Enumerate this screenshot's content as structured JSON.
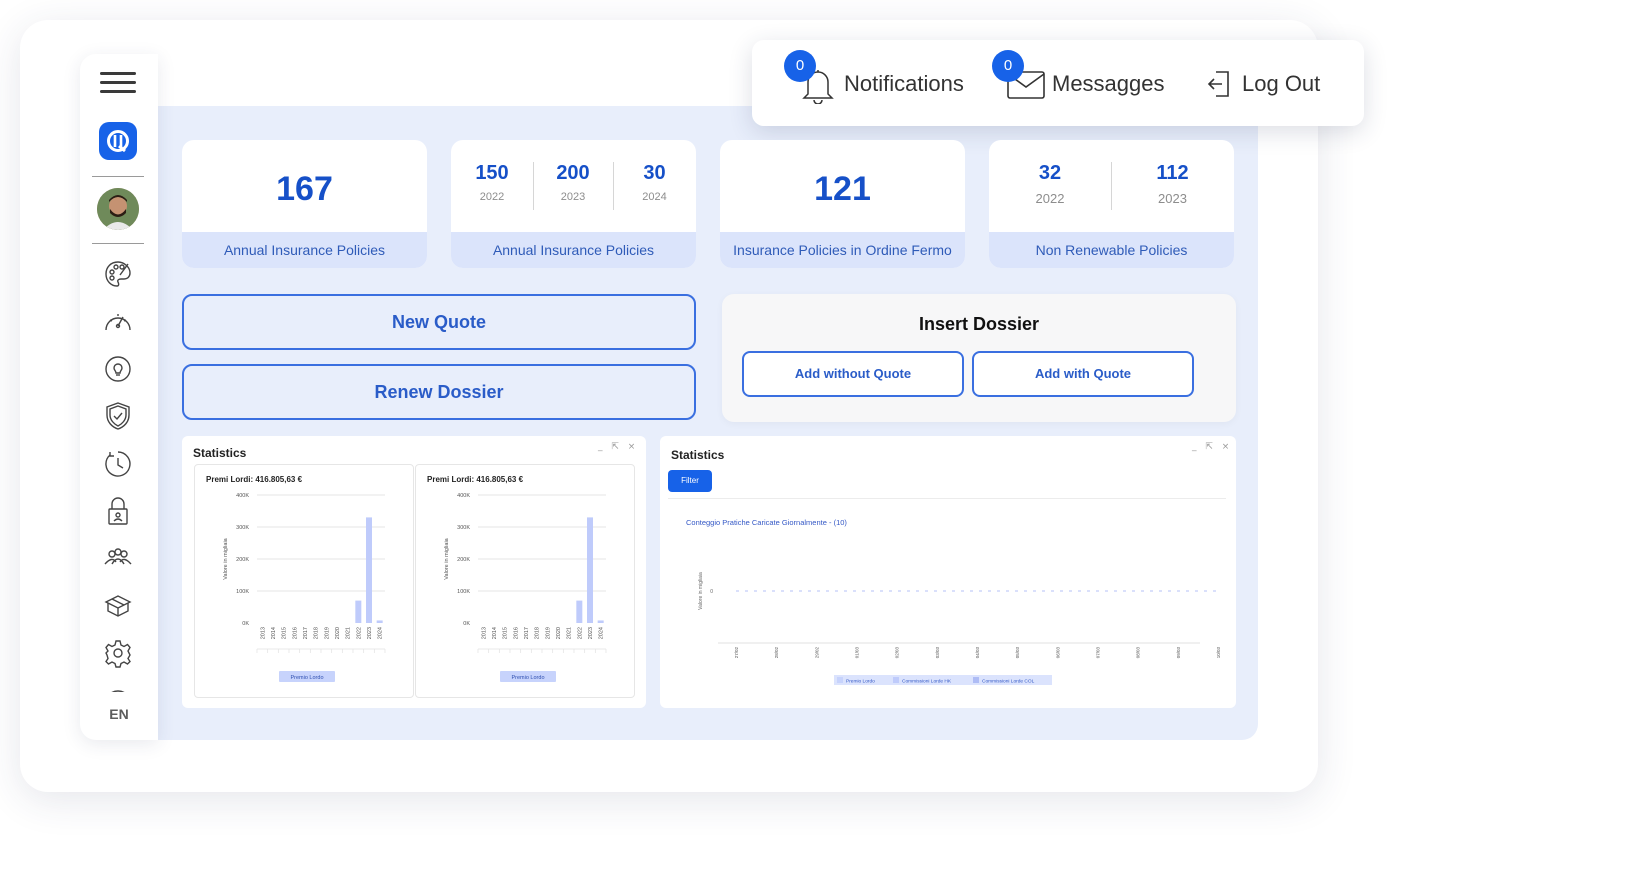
{
  "sidebar": {
    "language": "EN",
    "icons": [
      "palette-icon",
      "speedometer-icon",
      "lightbulb-icon",
      "shield-check-icon",
      "clock-icon",
      "lock-icon",
      "users-icon",
      "package-icon",
      "gear-icon"
    ]
  },
  "header": {
    "notifications": {
      "label": "Notifications",
      "count": "0"
    },
    "messages": {
      "label": "Messagges",
      "count": "0"
    },
    "logout": {
      "label": "Log Out"
    }
  },
  "kpis": [
    {
      "value": "167",
      "label": "Annual Insurance Policies"
    },
    {
      "sub": [
        {
          "value": "150",
          "year": "2022"
        },
        {
          "value": "200",
          "year": "2023"
        },
        {
          "value": "30",
          "year": "2024"
        }
      ],
      "label": "Annual Insurance Policies"
    },
    {
      "value": "121",
      "label": "Insurance Policies in Ordine Fermo"
    },
    {
      "sub": [
        {
          "value": "32",
          "year": "2022"
        },
        {
          "value": "112",
          "year": "2023"
        }
      ],
      "label": "Non Renewable Policies"
    }
  ],
  "actions": {
    "new_quote": "New Quote",
    "renew_dossier": "Renew Dossier",
    "insert_dossier": {
      "title": "Insert Dossier",
      "add_without_quote": "Add without Quote",
      "add_with_quote": "Add with Quote"
    }
  },
  "stats_left": {
    "title": "Statistics",
    "controls": [
      "_",
      "⇱",
      "×"
    ]
  },
  "stats_right": {
    "title": "Statistics",
    "filter_label": "Filter",
    "controls": [
      "_",
      "⇱",
      "×"
    ]
  },
  "chart_data": [
    {
      "type": "bar",
      "title": "Premi Lordi: 416.805,63 €",
      "ylabel": "Valore in migliaia",
      "categories": [
        "2013",
        "2014",
        "2015",
        "2016",
        "2017",
        "2018",
        "2019",
        "2020",
        "2021",
        "2022",
        "2023",
        "2024"
      ],
      "series": [
        {
          "name": "Premio Lordo",
          "values": [
            0,
            0,
            0,
            0,
            0,
            0,
            0,
            0,
            0,
            70000,
            330000,
            8000
          ]
        }
      ],
      "ylim": [
        0,
        400000
      ],
      "yticks": [
        "0K",
        "100K",
        "200K",
        "300K",
        "400K"
      ],
      "grid": true,
      "legend": "bottom"
    },
    {
      "type": "bar",
      "title": "Premi Lordi: 416.805,63 €",
      "ylabel": "Valore in migliaia",
      "categories": [
        "2013",
        "2014",
        "2015",
        "2016",
        "2017",
        "2018",
        "2019",
        "2020",
        "2021",
        "2022",
        "2023",
        "2024"
      ],
      "series": [
        {
          "name": "Premio Lordo",
          "values": [
            0,
            0,
            0,
            0,
            0,
            0,
            0,
            0,
            0,
            70000,
            330000,
            8000
          ]
        }
      ],
      "ylim": [
        0,
        400000
      ],
      "yticks": [
        "0K",
        "100K",
        "200K",
        "300K",
        "400K"
      ],
      "grid": true,
      "legend": "bottom"
    },
    {
      "type": "line",
      "title": "Conteggio Pratiche Caricate Giornalmente - (10)",
      "ylabel": "Valore in migliaia",
      "categories": [
        "27/02",
        "28/02",
        "29/02",
        "01/03",
        "02/03",
        "03/03",
        "04/03",
        "05/03",
        "06/03",
        "07/03",
        "08/03",
        "09/03",
        "10/03"
      ],
      "yticks": [
        "0"
      ],
      "series": [
        {
          "name": "Premio Lordo",
          "values": [
            0,
            0,
            0,
            0,
            0,
            0,
            0,
            0,
            0,
            0,
            0,
            0,
            0
          ]
        },
        {
          "name": "Commissioni Lorde HK",
          "values": [
            0,
            0,
            0,
            0,
            0,
            0,
            0,
            0,
            0,
            0,
            0,
            0,
            0
          ]
        },
        {
          "name": "Commissioni Lorde COL",
          "values": [
            0,
            0,
            0,
            0,
            0,
            0,
            0,
            0,
            0,
            0,
            0,
            0,
            0
          ]
        }
      ],
      "legend": "bottom"
    }
  ]
}
